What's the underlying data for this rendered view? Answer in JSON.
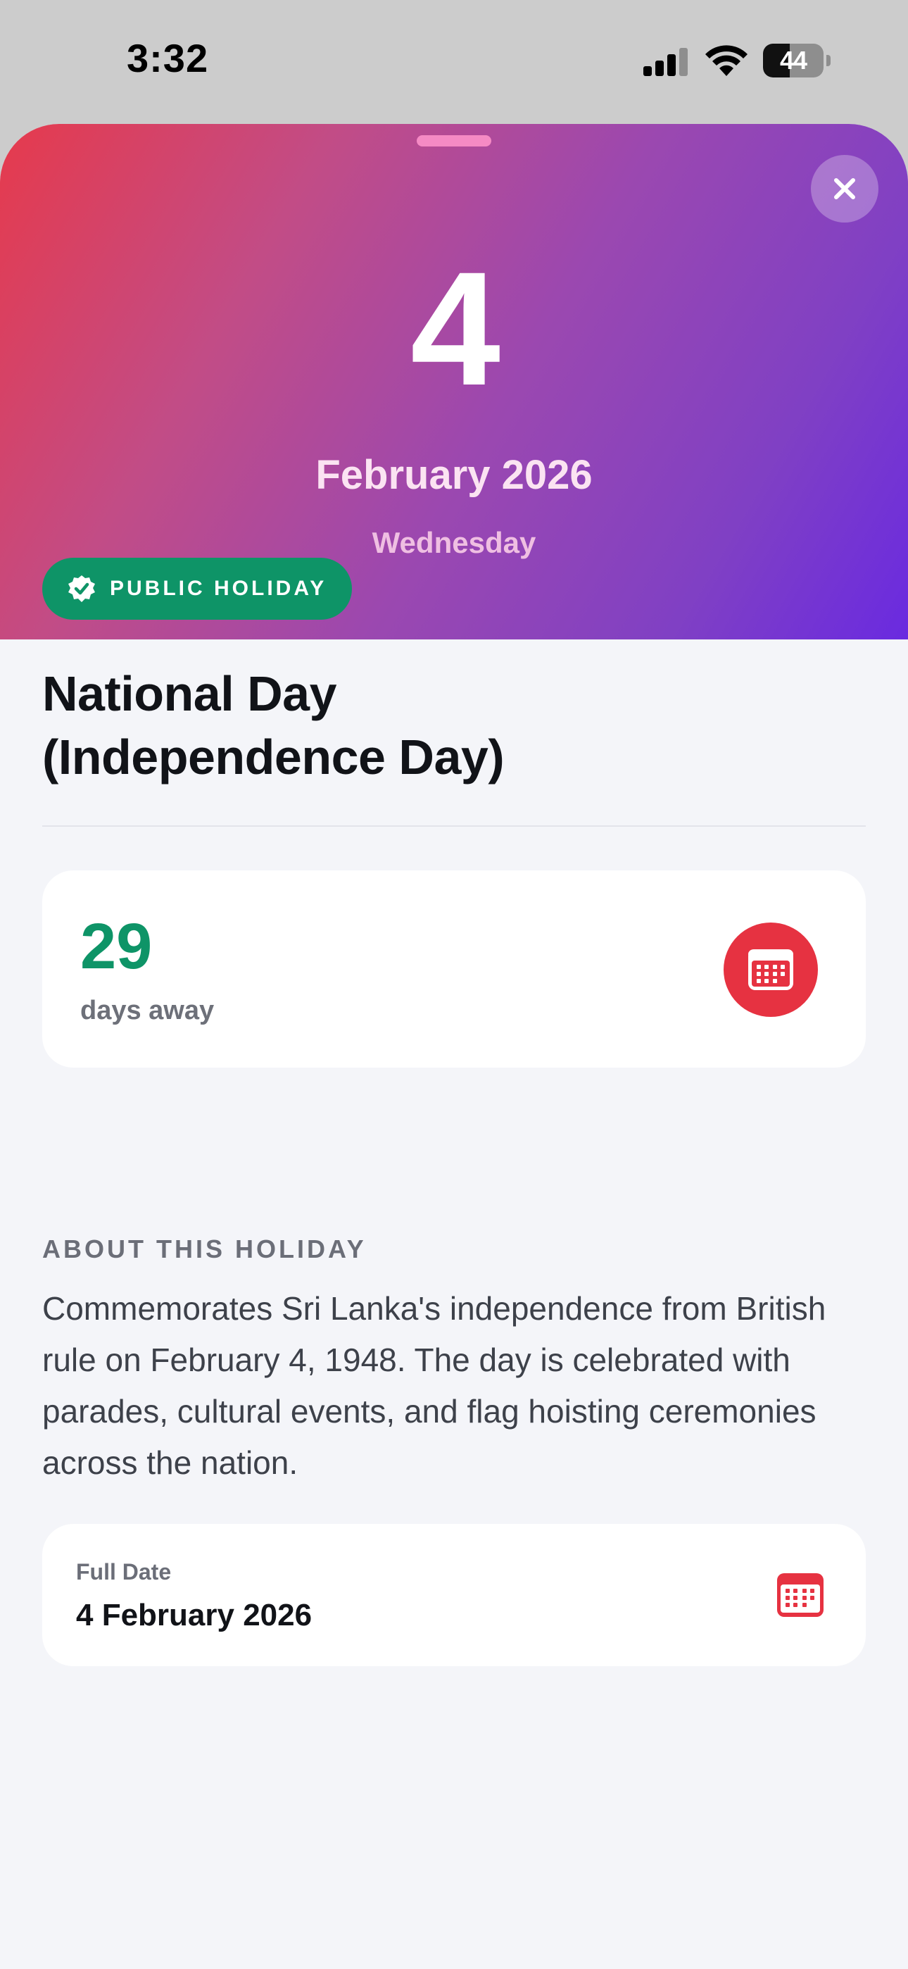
{
  "status_bar": {
    "time": "3:32",
    "battery_level": "44",
    "battery_fraction": 0.44
  },
  "hero": {
    "day": "4",
    "month_year": "February 2026",
    "weekday": "Wednesday",
    "gradient_colors": [
      "#e63a4c",
      "#9b48b0",
      "#6a2ae0"
    ]
  },
  "holiday": {
    "badge": "PUBLIC HOLIDAY",
    "title_line1": "National Day",
    "title_line2": "(Independence Day)"
  },
  "countdown": {
    "number": "29",
    "label": "days away"
  },
  "about": {
    "heading": "ABOUT THIS HOLIDAY",
    "description": "Commemorates Sri Lanka's independence from British rule on February 4, 1948. The day is celebrated with parades, cultural events, and flag hoisting ceremonies across the nation."
  },
  "full_date": {
    "label": "Full Date",
    "value": "4 February 2026"
  },
  "colors": {
    "accent_green": "#0e9467",
    "accent_red": "#e63241",
    "background": "#f4f5f9"
  },
  "icons": [
    "signal-icon",
    "wifi-icon",
    "battery-icon",
    "close-icon",
    "verified-badge-icon",
    "calendar-icon"
  ]
}
